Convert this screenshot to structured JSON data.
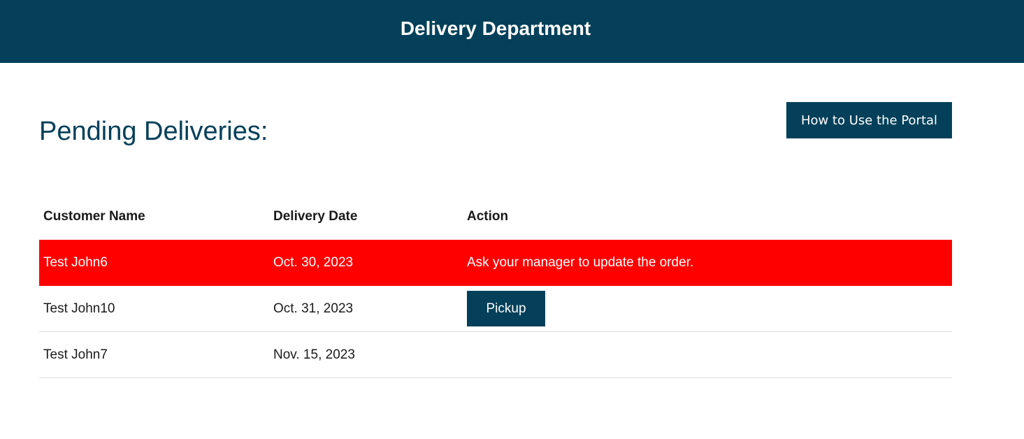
{
  "header": {
    "title": "Delivery Department"
  },
  "page": {
    "title": "Pending Deliveries:",
    "help_button": "How to Use the Portal"
  },
  "table": {
    "columns": [
      "Customer Name",
      "Delivery Date",
      "Action"
    ],
    "rows": [
      {
        "customer": "Test John6",
        "date": "Oct. 30, 2023",
        "action_text": "Ask your manager to update the order.",
        "highlight": "#ff0000"
      },
      {
        "customer": "Test John10",
        "date": "Oct. 31, 2023",
        "action_button": "Pickup"
      },
      {
        "customer": "Test John7",
        "date": "Nov. 15, 2023"
      }
    ]
  },
  "colors": {
    "brand": "#04405a",
    "alert": "#ff0000"
  }
}
